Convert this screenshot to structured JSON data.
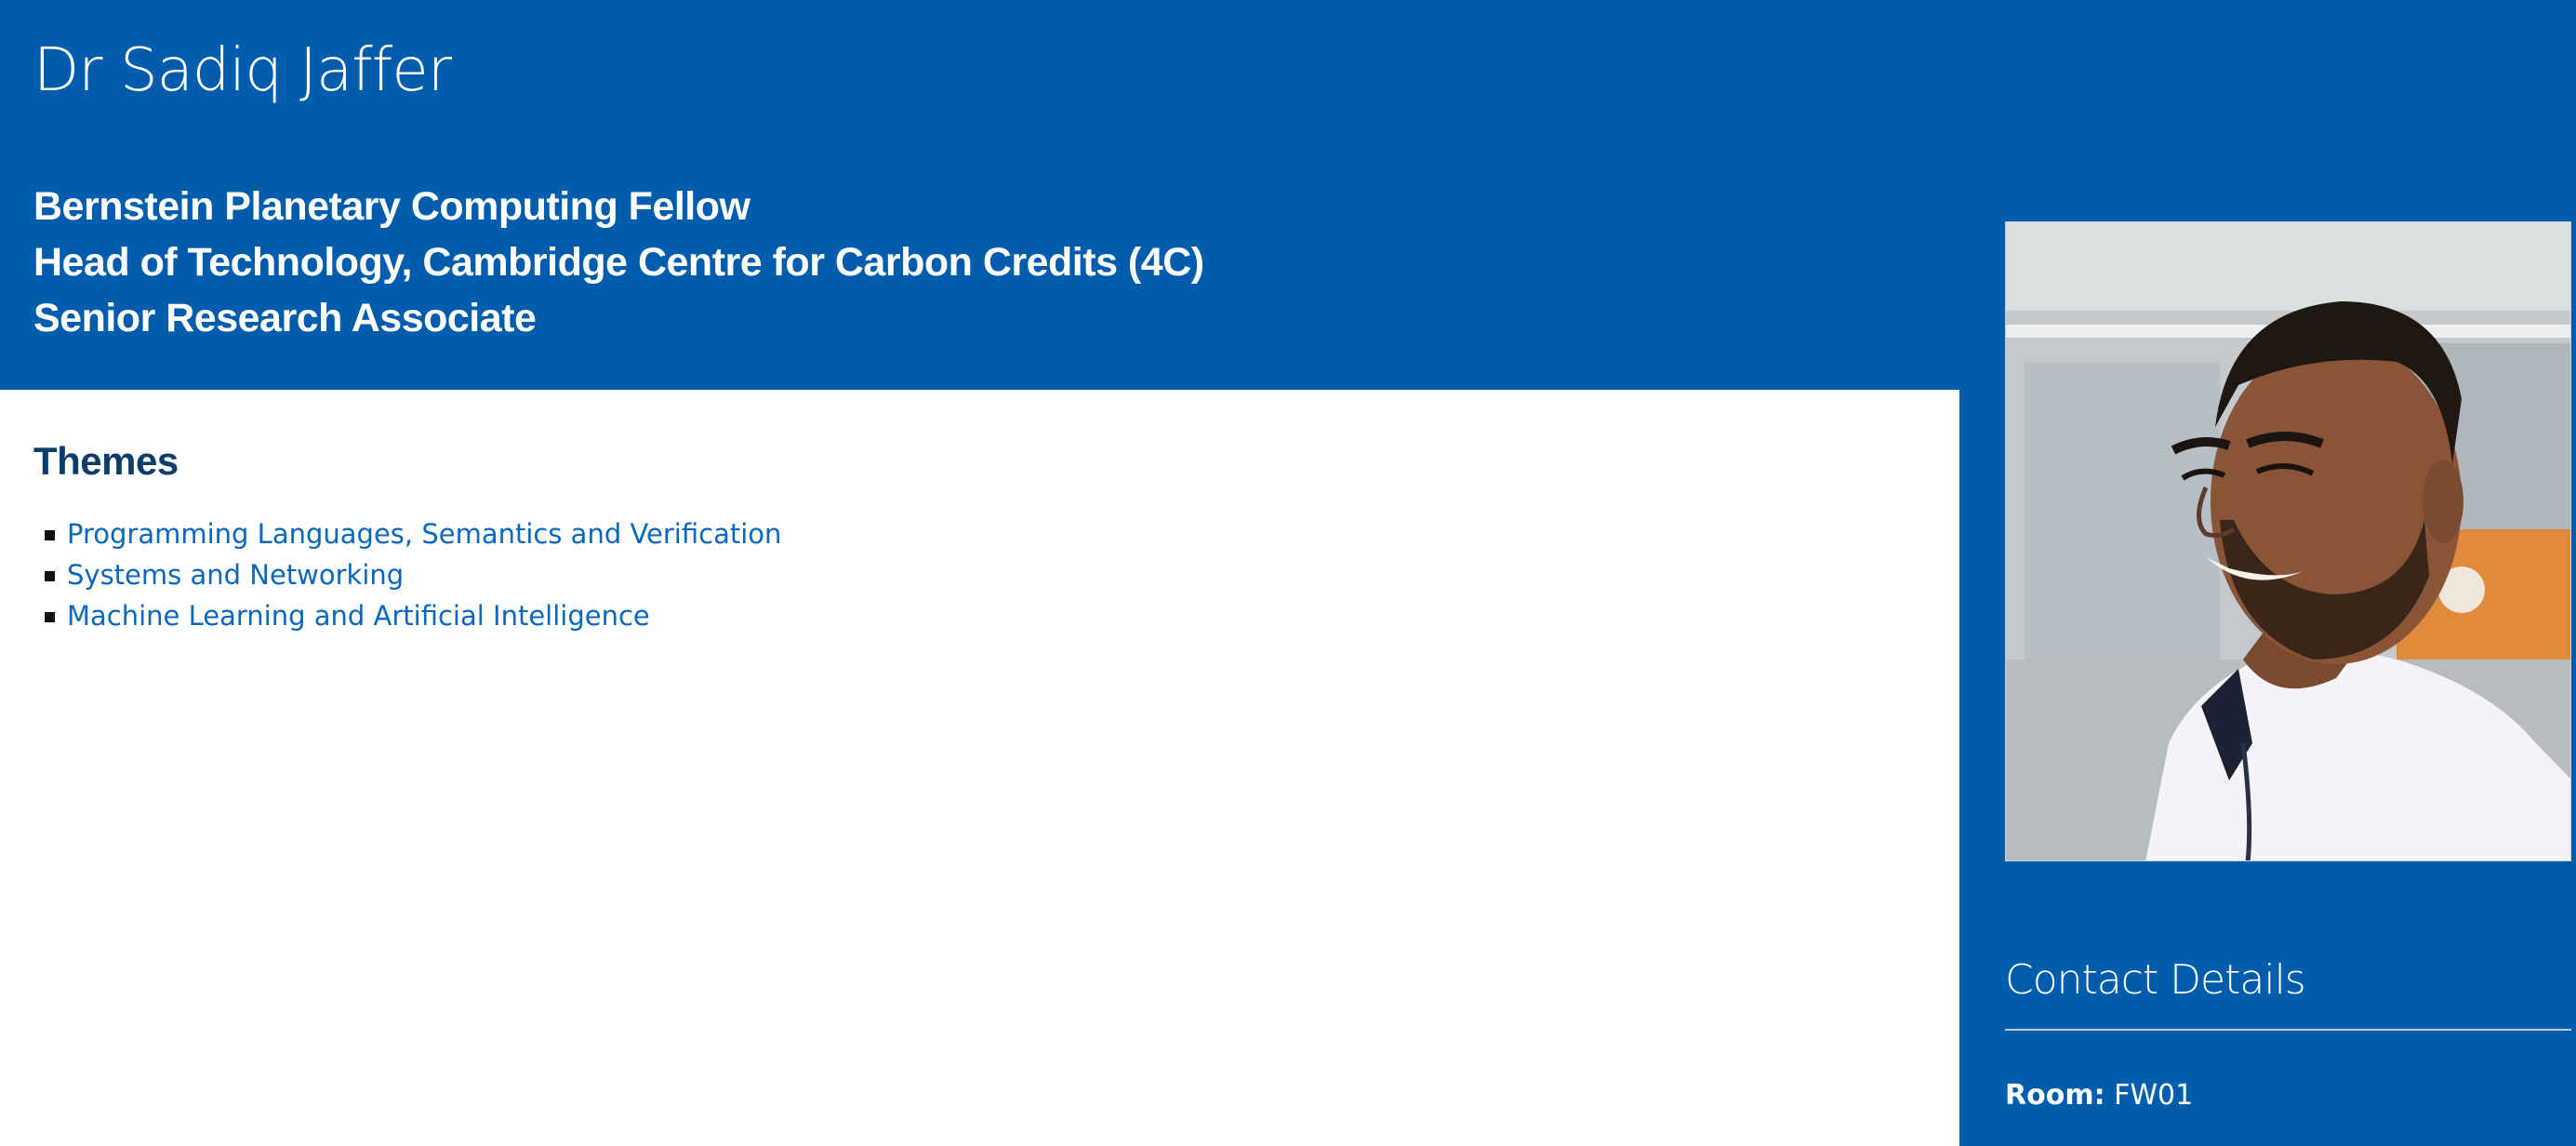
{
  "profile": {
    "name": "Dr Sadiq Jaffer",
    "titles": [
      "Bernstein Planetary Computing Fellow",
      "Head of Technology, Cambridge Centre for Carbon Credits (4C)",
      "Senior Research Associate"
    ]
  },
  "themes": {
    "heading": "Themes",
    "items": [
      "Programming Languages, Semantics and Verification",
      "Systems and Networking",
      "Machine Learning and Artificial Intelligence"
    ]
  },
  "sidebar": {
    "photo_alt": "Dr Sadiq Jaffer",
    "contact_heading": "Contact Details",
    "room_label": "Room:",
    "room_value": "FW01"
  },
  "colors": {
    "brand_blue": "#005dad",
    "heading_navy": "#0b3d6b",
    "link_blue": "#0a67be"
  }
}
